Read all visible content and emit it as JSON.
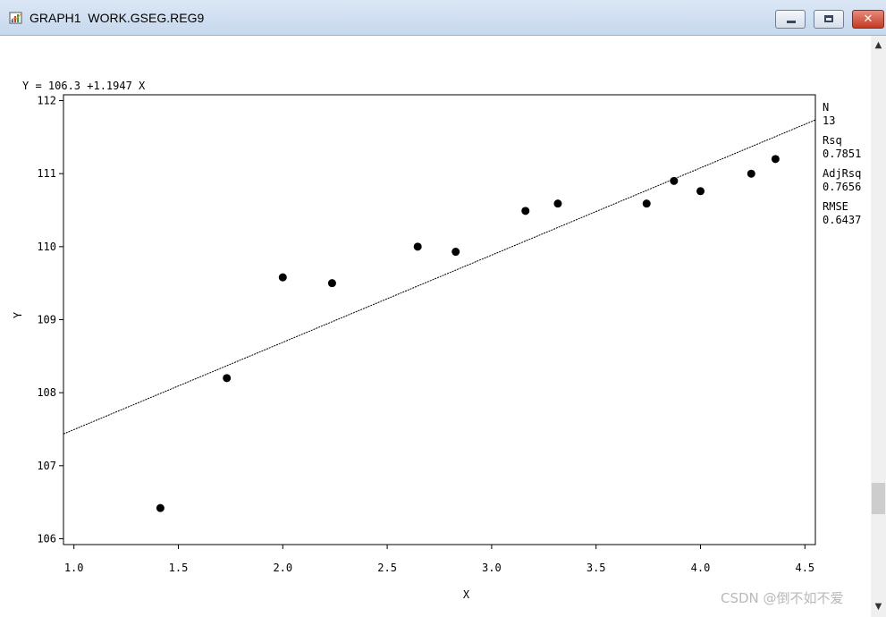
{
  "window": {
    "title": "GRAPH1  WORK.GSEG.REG9",
    "icon": "graph-window-icon",
    "controls": {
      "minimize": "minimize-icon",
      "maximize": "maximize-icon",
      "close": "close-icon"
    }
  },
  "scrollbar": {
    "up_icon": "scroll-up-arrow-icon",
    "down_icon": "scroll-down-arrow-icon"
  },
  "chart_data": {
    "type": "scatter",
    "equation": "Y = 106.3 +1.1947 X",
    "xlabel": "X",
    "ylabel": "Y",
    "xlim": [
      0.95,
      4.55
    ],
    "ylim": [
      105.92,
      112.08
    ],
    "xticks": [
      "1.0",
      "1.5",
      "2.0",
      "2.5",
      "3.0",
      "3.5",
      "4.0",
      "4.5"
    ],
    "yticks": [
      "106",
      "107",
      "108",
      "109",
      "110",
      "111",
      "112"
    ],
    "grid": false,
    "fit_line": {
      "intercept": 106.3,
      "slope": 1.1947
    },
    "points": [
      [
        1.414,
        106.42
      ],
      [
        1.732,
        108.2
      ],
      [
        2.0,
        109.58
      ],
      [
        2.236,
        109.5
      ],
      [
        2.646,
        110.0
      ],
      [
        2.828,
        109.93
      ],
      [
        3.162,
        110.49
      ],
      [
        3.317,
        110.59
      ],
      [
        3.742,
        110.59
      ],
      [
        3.873,
        110.9
      ],
      [
        4.0,
        110.76
      ],
      [
        4.243,
        111.0
      ],
      [
        4.359,
        111.2
      ]
    ],
    "stats": [
      {
        "label": "N",
        "value": "13"
      },
      {
        "label": "Rsq",
        "value": "0.7851"
      },
      {
        "label": "AdjRsq",
        "value": "0.7656"
      },
      {
        "label": "RMSE",
        "value": "0.6437"
      }
    ]
  },
  "watermark": "CSDN @倒不如不爱"
}
